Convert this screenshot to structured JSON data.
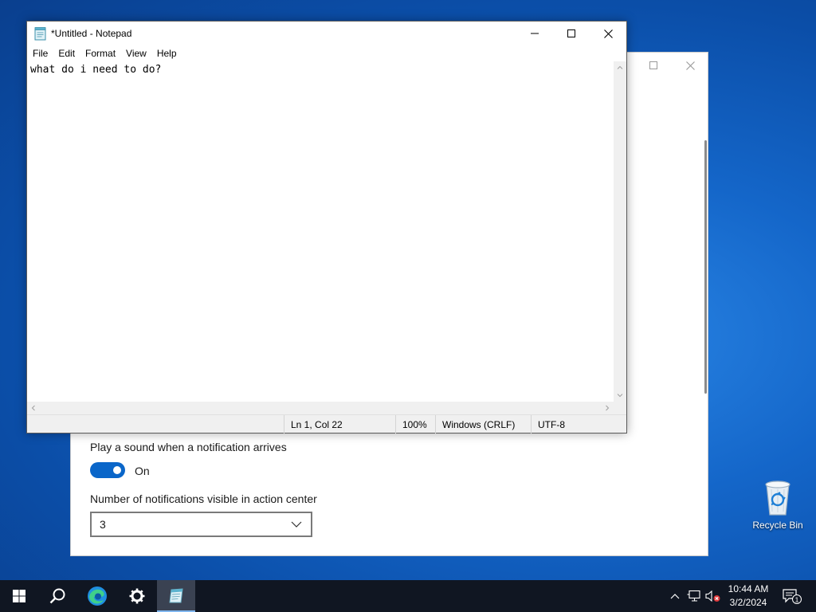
{
  "settings": {
    "sound_label": "Play a sound when a notification arrives",
    "sound_toggle_state": "On",
    "count_label": "Number of notifications visible in action center",
    "count_value": "3"
  },
  "notepad": {
    "title": "*Untitled - Notepad",
    "menu": [
      "File",
      "Edit",
      "Format",
      "View",
      "Help"
    ],
    "content": "what do i need to do?",
    "status": {
      "position": "Ln 1, Col 22",
      "zoom": "100%",
      "line_ending": "Windows (CRLF)",
      "encoding": "UTF-8"
    }
  },
  "desktop": {
    "recycle_bin_label": "Recycle Bin"
  },
  "taskbar": {
    "time": "10:44 AM",
    "date": "3/2/2024",
    "notification_count": "1"
  },
  "colors": {
    "accent": "#0a66c9",
    "taskbar": "#101622"
  }
}
